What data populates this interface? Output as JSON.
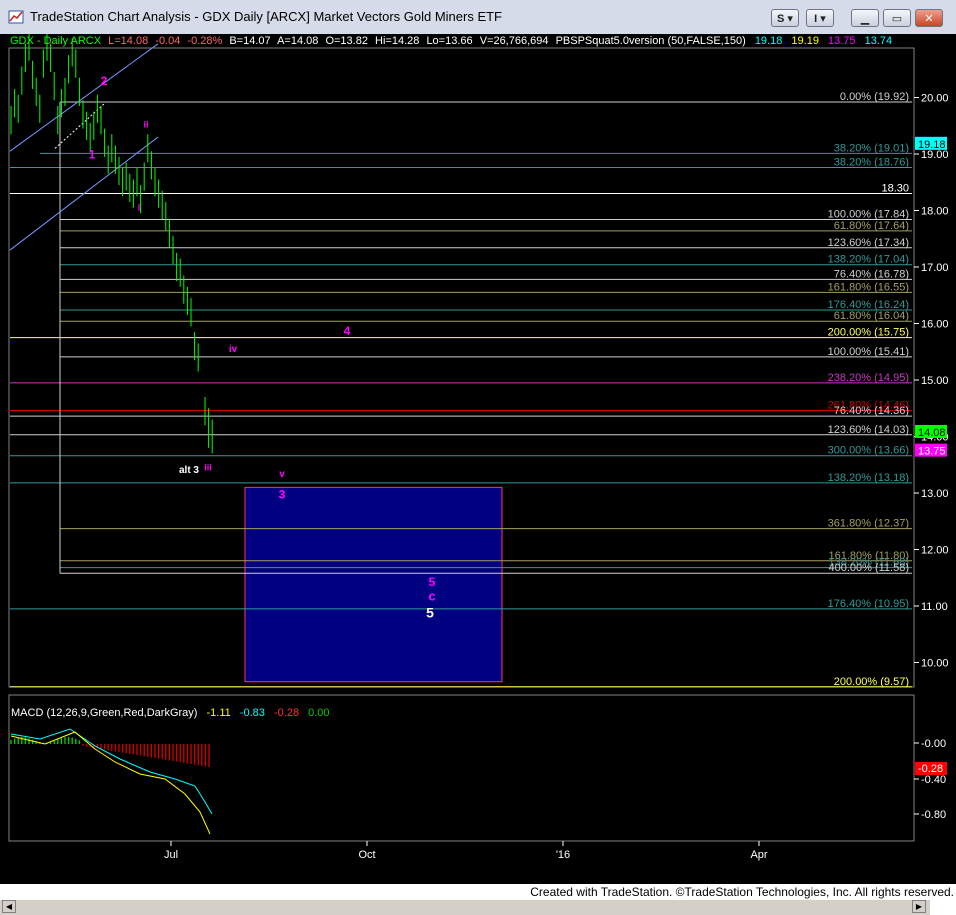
{
  "window": {
    "title": "TradeStation Chart Analysis - GDX Daily [ARCX] Market Vectors Gold Miners ETF",
    "s_button": "S",
    "i_button": "I"
  },
  "header": {
    "symbol": "GDX - Daily  ARCX",
    "last": "L=14.08",
    "change": "-0.04",
    "pct": "-0.28%",
    "bid": "B=14.07",
    "ask": "A=14.08",
    "open": "O=13.82",
    "high": "Hi=14.28",
    "low": "Lo=13.66",
    "volume": "V=26,766,694",
    "indicator": "PBSPSquat5.0version (50,FALSE,150)",
    "v1": "19.18",
    "v2": "19.19",
    "v3": "13.75",
    "v4": "13.74"
  },
  "price_axis": [
    "20.00",
    "19.00",
    "18.00",
    "17.00",
    "16.00",
    "15.00",
    "14.00",
    "13.00",
    "12.00",
    "11.00",
    "10.00"
  ],
  "price_tags": [
    {
      "text": "19.18",
      "bg": "#00ffff",
      "fg": "#000000"
    },
    {
      "text": "14.08",
      "bg": "#00ff00",
      "fg": "#000000"
    },
    {
      "text": "13.75",
      "bg": "#ff00ff",
      "fg": "#ffffff"
    }
  ],
  "fib_levels": [
    {
      "price": 19.92,
      "label": "0.00% (19.92)",
      "color": "#d0d0d0"
    },
    {
      "price": 19.01,
      "label": "38.20% (19.01)",
      "color": "#339999"
    },
    {
      "price": 18.76,
      "label": "38.20% (18.76)",
      "color": "#339999"
    },
    {
      "price": 18.3,
      "label": "18.30",
      "color": "#ffffff"
    },
    {
      "price": 17.84,
      "label": "100.00% (17.84)",
      "color": "#d0d0d0"
    },
    {
      "price": 17.64,
      "label": "61.80% (17.64)",
      "color": "#a0a060"
    },
    {
      "price": 17.34,
      "label": "123.60% (17.34)",
      "color": "#d0d0d0"
    },
    {
      "price": 17.04,
      "label": "138.20% (17.04)",
      "color": "#339999"
    },
    {
      "price": 16.78,
      "label": "76.40% (16.78)",
      "color": "#d0d0d0"
    },
    {
      "price": 16.55,
      "label": "161.80% (16.55)",
      "color": "#a0a060"
    },
    {
      "price": 16.24,
      "label": "176.40% (16.24)",
      "color": "#339999"
    },
    {
      "price": 16.04,
      "label": "61.80% (16.04)",
      "color": "#a0a060"
    },
    {
      "price": 15.75,
      "label": "200.00% (15.75)",
      "color": "#ffff66"
    },
    {
      "price": 15.41,
      "label": "100.00% (15.41)",
      "color": "#d0d0d0"
    },
    {
      "price": 14.95,
      "label": "238.20% (14.95)",
      "color": "#cc33cc"
    },
    {
      "price": 14.46,
      "label": "261.80% (14.46)",
      "color": "#cc0000"
    },
    {
      "price": 14.36,
      "label": "76.40% (14.36)",
      "color": "#d0d0d0"
    },
    {
      "price": 14.03,
      "label": "123.60% (14.03)",
      "color": "#d0d0d0"
    },
    {
      "price": 13.66,
      "label": "300.00% (13.66)",
      "color": "#339999"
    },
    {
      "price": 13.18,
      "label": "138.20% (13.18)",
      "color": "#339999"
    },
    {
      "price": 12.37,
      "label": "361.80% (12.37)",
      "color": "#a0a060"
    },
    {
      "price": 11.8,
      "label": "161.80% (11.80)",
      "color": "#a0a060"
    },
    {
      "price": 11.68,
      "label": "138.20% (11.68)",
      "color": "#339999"
    },
    {
      "price": 11.58,
      "label": "400.00% (11.58)",
      "color": "#d0d0d0"
    },
    {
      "price": 10.95,
      "label": "176.40% (10.95)",
      "color": "#339999"
    },
    {
      "price": 9.57,
      "label": "200.00% (9.57)",
      "color": "#ffff66"
    }
  ],
  "wave_labels": [
    {
      "text": "1",
      "color": "#ff00ff"
    },
    {
      "text": "2",
      "color": "#ff00ff"
    },
    {
      "text": "ii",
      "color": "#ff00ff"
    },
    {
      "text": "i",
      "color": "#ff00ff"
    },
    {
      "text": "4",
      "color": "#ff00ff"
    },
    {
      "text": "iv",
      "color": "#ff00ff"
    },
    {
      "text": "alt 3",
      "color": "#ffffff"
    },
    {
      "text": "iii",
      "color": "#ff00ff"
    },
    {
      "text": "v",
      "color": "#ff00ff"
    },
    {
      "text": "3",
      "color": "#ff00ff"
    },
    {
      "text": "5",
      "color": "#ff00ff"
    },
    {
      "text": "c",
      "color": "#ff00ff"
    },
    {
      "text": "5",
      "color": "#ffffff"
    }
  ],
  "target_box": {
    "fill": "#000080",
    "border": "#ff3366"
  },
  "macd": {
    "title": "MACD (12,26,9,Green,Red,DarkGray)",
    "v1": "-1.11",
    "v2": "-0.83",
    "v3": "-0.28",
    "v4": "0.00",
    "axis": [
      "-0.00",
      "-0.40",
      "-0.80"
    ],
    "tag": "-0.28"
  },
  "x_axis": [
    "Jul",
    "Oct",
    "'16",
    "Apr"
  ],
  "footer": "Created with TradeStation. ©TradeStation Technologies, Inc. All rights reserved."
}
